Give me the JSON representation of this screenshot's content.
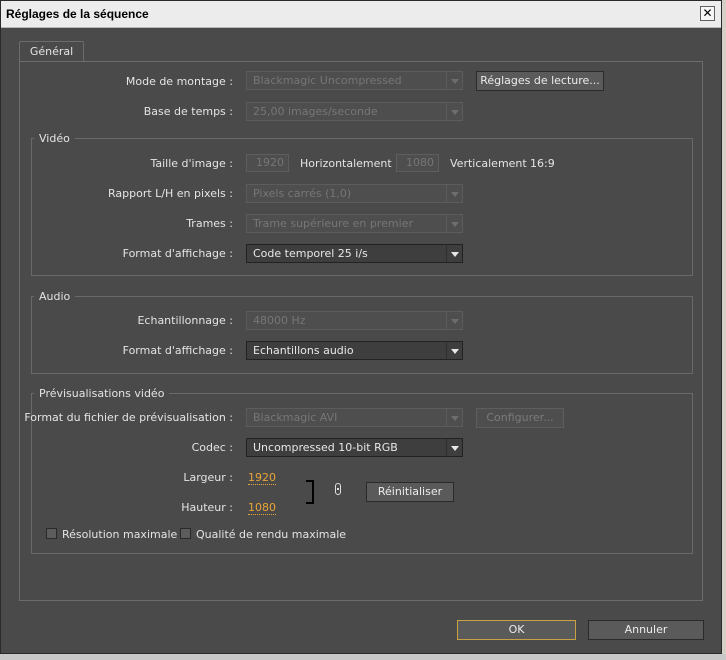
{
  "window": {
    "title": "Réglages de la séquence",
    "close_glyph": "✕"
  },
  "tab": {
    "label": "Général"
  },
  "general": {
    "edit_mode": {
      "label": "Mode de montage :",
      "value": "Blackmagic Uncompressed"
    },
    "playback_button": "Réglages de lecture...",
    "timebase": {
      "label": "Base de temps :",
      "value": "25,00 images/seconde"
    }
  },
  "video": {
    "title": "Vidéo",
    "frame_size": {
      "label": "Taille d'image :",
      "width": "1920",
      "h_label": "Horizontalement",
      "height": "1080",
      "v_label": "Verticalement",
      "ratio": "16:9"
    },
    "pixel_aspect": {
      "label": "Rapport L/H en pixels :",
      "value": "Pixels carrés (1,0)"
    },
    "fields": {
      "label": "Trames :",
      "value": "Trame supérieure en premier"
    },
    "display_format": {
      "label": "Format d'affichage :",
      "value": "Code temporel 25 i/s"
    }
  },
  "audio": {
    "title": "Audio",
    "sample_rate": {
      "label": "Echantillonnage :",
      "value": "48000 Hz"
    },
    "display_format": {
      "label": "Format d'affichage :",
      "value": "Echantillons audio"
    }
  },
  "preview": {
    "title": "Prévisualisations vidéo",
    "file_format": {
      "label": "Format du fichier de prévisualisation :",
      "value": "Blackmagic AVI"
    },
    "configure_button": "Configurer...",
    "codec": {
      "label": "Codec :",
      "value": "Uncompressed 10-bit RGB"
    },
    "width": {
      "label": "Largeur :",
      "value": "1920"
    },
    "height": {
      "label": "Hauteur :",
      "value": "1080"
    },
    "reset_button": "Réinitialiser",
    "max_resolution": "Résolution maximale",
    "max_quality": "Qualité de rendu maximale"
  },
  "buttons": {
    "ok": "OK",
    "cancel": "Annuler"
  },
  "colors": {
    "background": "#4a4a4a",
    "accent": "#e8a53a",
    "focus_border": "#c8a242"
  }
}
